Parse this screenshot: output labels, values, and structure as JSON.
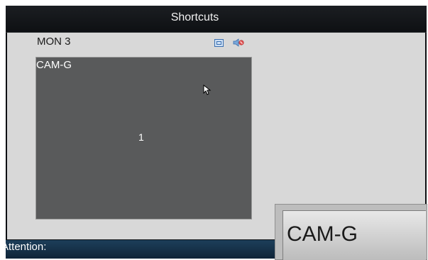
{
  "window": {
    "title": "Shortcuts"
  },
  "panel": {
    "monitor_label": "MON 3",
    "icons": [
      "fullscreen-icon",
      "audio-mute-icon"
    ],
    "preview": {
      "camera_label": "CAM-G",
      "window_number": "1"
    }
  },
  "status": {
    "attention_label": "Attention:"
  },
  "overlay": {
    "camera_name": "CAM-G"
  },
  "colors": {
    "preview_bg": "#595a5b",
    "content_bg": "#d8d8d8",
    "titlebar_bg": "#0e1013",
    "statusbar_bg": "#1d3f5a",
    "icon_blue": "#3a6fb0",
    "audio_red": "#d04040"
  }
}
